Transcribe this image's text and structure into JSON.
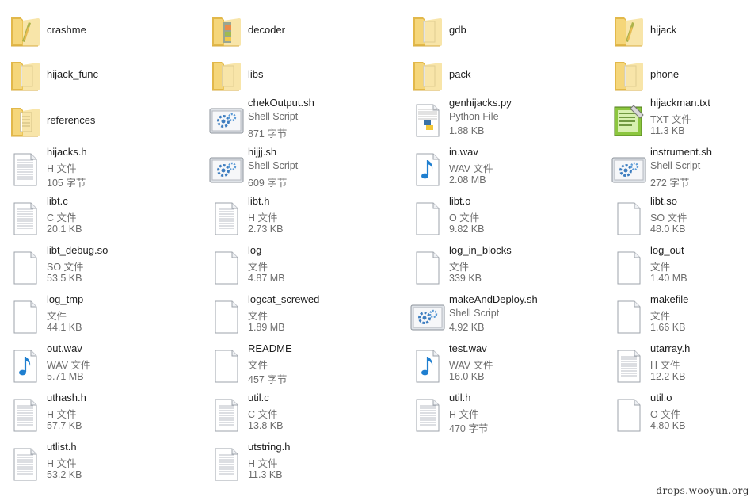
{
  "items": [
    {
      "name": "crashme",
      "kind": "folder-app"
    },
    {
      "name": "decoder",
      "kind": "folder-color"
    },
    {
      "name": "gdb",
      "kind": "folder-plain"
    },
    {
      "name": "hijack",
      "kind": "folder-app"
    },
    {
      "name": "hijack_func",
      "kind": "folder-plain"
    },
    {
      "name": "libs",
      "kind": "folder-plain"
    },
    {
      "name": "pack",
      "kind": "folder-plain"
    },
    {
      "name": "phone",
      "kind": "folder-plain"
    },
    {
      "name": "references",
      "kind": "folder-docs"
    },
    {
      "name": "chekOutput.sh",
      "type": "Shell Script",
      "size": "871 字节",
      "kind": "shell"
    },
    {
      "name": "genhijacks.py",
      "type": "Python File",
      "size": "1.88 KB",
      "kind": "python"
    },
    {
      "name": "hijackman.txt",
      "type": "TXT 文件",
      "size": "11.3 KB",
      "kind": "notepad"
    },
    {
      "name": "hijacks.h",
      "type": "H 文件",
      "size": "105 字节",
      "kind": "lines"
    },
    {
      "name": "hijjj.sh",
      "type": "Shell Script",
      "size": "609 字节",
      "kind": "shell"
    },
    {
      "name": "in.wav",
      "type": "WAV 文件",
      "size": "2.08 MB",
      "kind": "audio"
    },
    {
      "name": "instrument.sh",
      "type": "Shell Script",
      "size": "272 字节",
      "kind": "shell"
    },
    {
      "name": "libt.c",
      "type": "C 文件",
      "size": "20.1 KB",
      "kind": "lines"
    },
    {
      "name": "libt.h",
      "type": "H 文件",
      "size": "2.73 KB",
      "kind": "lines"
    },
    {
      "name": "libt.o",
      "type": "O 文件",
      "size": "9.82 KB",
      "kind": "blank"
    },
    {
      "name": "libt.so",
      "type": "SO 文件",
      "size": "48.0 KB",
      "kind": "blank"
    },
    {
      "name": "libt_debug.so",
      "type": "SO 文件",
      "size": "53.5 KB",
      "kind": "blank"
    },
    {
      "name": "log",
      "type": "文件",
      "size": "4.87 MB",
      "kind": "blank"
    },
    {
      "name": "log_in_blocks",
      "type": "文件",
      "size": "339 KB",
      "kind": "blank"
    },
    {
      "name": "log_out",
      "type": "文件",
      "size": "1.40 MB",
      "kind": "blank"
    },
    {
      "name": "log_tmp",
      "type": "文件",
      "size": "44.1 KB",
      "kind": "blank"
    },
    {
      "name": "logcat_screwed",
      "type": "文件",
      "size": "1.89 MB",
      "kind": "blank"
    },
    {
      "name": "makeAndDeploy.sh",
      "type": "Shell Script",
      "size": "4.92 KB",
      "kind": "shell"
    },
    {
      "name": "makefile",
      "type": "文件",
      "size": "1.66 KB",
      "kind": "blank"
    },
    {
      "name": "out.wav",
      "type": "WAV 文件",
      "size": "5.71 MB",
      "kind": "audio"
    },
    {
      "name": "README",
      "type": "文件",
      "size": "457 字节",
      "kind": "blank"
    },
    {
      "name": "test.wav",
      "type": "WAV 文件",
      "size": "16.0 KB",
      "kind": "audio"
    },
    {
      "name": "utarray.h",
      "type": "H 文件",
      "size": "12.2 KB",
      "kind": "lines"
    },
    {
      "name": "uthash.h",
      "type": "H 文件",
      "size": "57.7 KB",
      "kind": "lines"
    },
    {
      "name": "util.c",
      "type": "C 文件",
      "size": "13.8 KB",
      "kind": "lines"
    },
    {
      "name": "util.h",
      "type": "H 文件",
      "size": "470 字节",
      "kind": "lines"
    },
    {
      "name": "util.o",
      "type": "O 文件",
      "size": "4.80 KB",
      "kind": "blank"
    },
    {
      "name": "utlist.h",
      "type": "H 文件",
      "size": "53.2 KB",
      "kind": "lines"
    },
    {
      "name": "utstring.h",
      "type": "H 文件",
      "size": "11.3 KB",
      "kind": "lines"
    }
  ],
  "watermark": "drops.wooyun.org",
  "colors": {
    "text": "#1e1e1e",
    "meta": "#6d6d6d",
    "folder": "#f5d67a",
    "folder_dark": "#e2b84a"
  }
}
